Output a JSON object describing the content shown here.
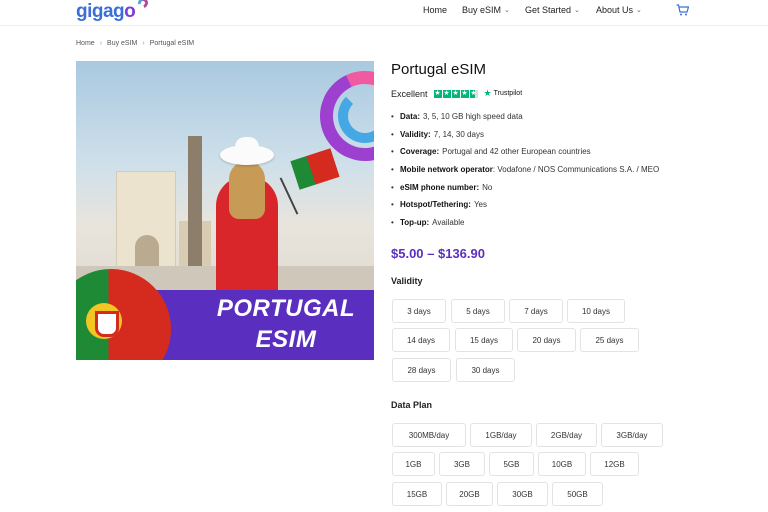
{
  "header": {
    "logo": {
      "text_a": "gigag",
      "text_b": "o"
    },
    "nav": [
      {
        "label": "Home",
        "dropdown": false
      },
      {
        "label": "Buy eSIM",
        "dropdown": true
      },
      {
        "label": "Get Started",
        "dropdown": true
      },
      {
        "label": "About Us",
        "dropdown": true
      }
    ],
    "cart_icon": "cart-icon"
  },
  "breadcrumb": [
    "Home",
    "Buy eSIM",
    "Portugal eSIM"
  ],
  "hero": {
    "banner_line1": "PORTUGAL",
    "banner_line2": "ESIM"
  },
  "product": {
    "title": "Portugal eSIM",
    "rating_label": "Excellent",
    "rating_stars": 4.5,
    "trustpilot": "Trustpilot",
    "features": [
      {
        "label": "Data:",
        "value": "3, 5, 10 GB high speed data"
      },
      {
        "label": "Validity:",
        "value": "7, 14, 30 days"
      },
      {
        "label": "Coverage:",
        "value": "Portugal and 42 other European countries"
      },
      {
        "label": "Mobile network operator",
        "value": ": Vodafone / NOS Communications S.A. / MEO"
      },
      {
        "label": "eSIM phone number:",
        "value": "No"
      },
      {
        "label": "Hotspot/Tethering:",
        "value": "Yes"
      },
      {
        "label": "Top-up:",
        "value": "Available"
      }
    ],
    "price": "$5.00 – $136.90",
    "validity_label": "Validity",
    "validity_options": [
      "3 days",
      "5 days",
      "7 days",
      "10 days",
      "14 days",
      "15 days",
      "20 days",
      "25 days",
      "28 days",
      "30 days"
    ],
    "data_plan_label": "Data Plan",
    "data_plan_options": [
      "300MB/day",
      "1GB/day",
      "2GB/day",
      "3GB/day",
      "1GB",
      "3GB",
      "5GB",
      "10GB",
      "12GB",
      "15GB",
      "20GB",
      "30GB",
      "50GB"
    ]
  },
  "colors": {
    "accent": "#5a2fbf",
    "trustpilot_green": "#00b67a",
    "logo_blue": "#3b6fd8"
  }
}
